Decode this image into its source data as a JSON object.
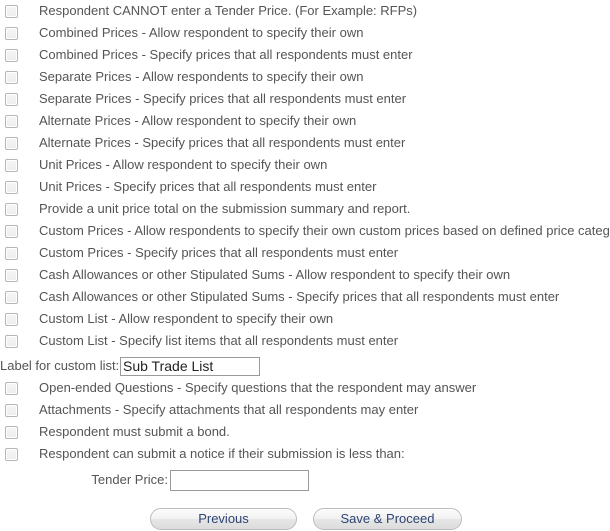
{
  "form": {
    "options": [
      {
        "label": "Respondent CANNOT enter a Tender Price. (For Example: RFPs)",
        "name": "respondent-cannot-enter-tender-price",
        "checked": false
      },
      {
        "label": "Combined Prices - Allow respondent to specify their own",
        "name": "combined-prices-allow-respondent",
        "checked": false
      },
      {
        "label": "Combined Prices - Specify prices that all respondents must enter",
        "name": "combined-prices-specify-prices",
        "checked": false
      },
      {
        "label": "Separate Prices - Allow respondents to specify their own",
        "name": "separate-prices-allow-respondents",
        "checked": false
      },
      {
        "label": "Separate Prices - Specify prices that all respondents must enter",
        "name": "separate-prices-specify-prices",
        "checked": false
      },
      {
        "label": "Alternate Prices - Allow respondent to specify their own",
        "name": "alternate-prices-allow-respondent",
        "checked": false
      },
      {
        "label": "Alternate Prices - Specify prices that all respondents must enter",
        "name": "alternate-prices-specify-prices",
        "checked": false
      },
      {
        "label": "Unit Prices - Allow respondent to specify their own",
        "name": "unit-prices-allow-respondent",
        "checked": false
      },
      {
        "label": "Unit Prices - Specify prices that all respondents must enter",
        "name": "unit-prices-specify-prices",
        "checked": false
      },
      {
        "label": "Provide a unit price total on the submission summary and report.",
        "name": "unit-price-total-on-summary",
        "checked": false
      },
      {
        "label": "Custom Prices - Allow respondents to specify their own custom prices based on defined price categories",
        "name": "custom-prices-allow-respondents",
        "checked": false
      },
      {
        "label": "Custom Prices - Specify prices that all respondents must enter",
        "name": "custom-prices-specify-prices",
        "checked": false
      },
      {
        "label": "Cash Allowances or other Stipulated Sums - Allow respondent to specify their own",
        "name": "cash-allowances-allow-respondent",
        "checked": false
      },
      {
        "label": "Cash Allowances or other Stipulated Sums - Specify prices that all respondents must enter",
        "name": "cash-allowances-specify-prices",
        "checked": false
      },
      {
        "label": "Custom List - Allow respondent to specify their own",
        "name": "custom-list-allow-respondent",
        "checked": false
      },
      {
        "label": "Custom List - Specify list items that all respondents must enter",
        "name": "custom-list-specify-list-items",
        "checked": false
      }
    ],
    "custom_list_label": {
      "label": "Label for custom list:",
      "value": "Sub Trade List",
      "placeholder": ""
    },
    "options_after": [
      {
        "label": "Open-ended Questions - Specify questions that the respondent may answer",
        "name": "open-ended-questions",
        "checked": false
      },
      {
        "label": "Attachments - Specify attachments that all respondents may enter",
        "name": "attachments-specify",
        "checked": false
      },
      {
        "label": "Respondent must submit a bond.",
        "name": "respondent-must-submit-bond",
        "checked": false
      },
      {
        "label": "Respondent can submit a notice if their submission is less than:",
        "name": "respondent-can-submit-notice",
        "checked": false
      }
    ],
    "tender_price": {
      "label": "Tender Price:",
      "value": "",
      "placeholder": ""
    },
    "buttons": {
      "previous": "Previous",
      "save_proceed": "Save & Proceed"
    },
    "colors": {
      "text": "#555555",
      "button_text": "#2d4373",
      "input_border": "#9a9a9a",
      "checkbox_border": "#b6b6b6"
    }
  }
}
